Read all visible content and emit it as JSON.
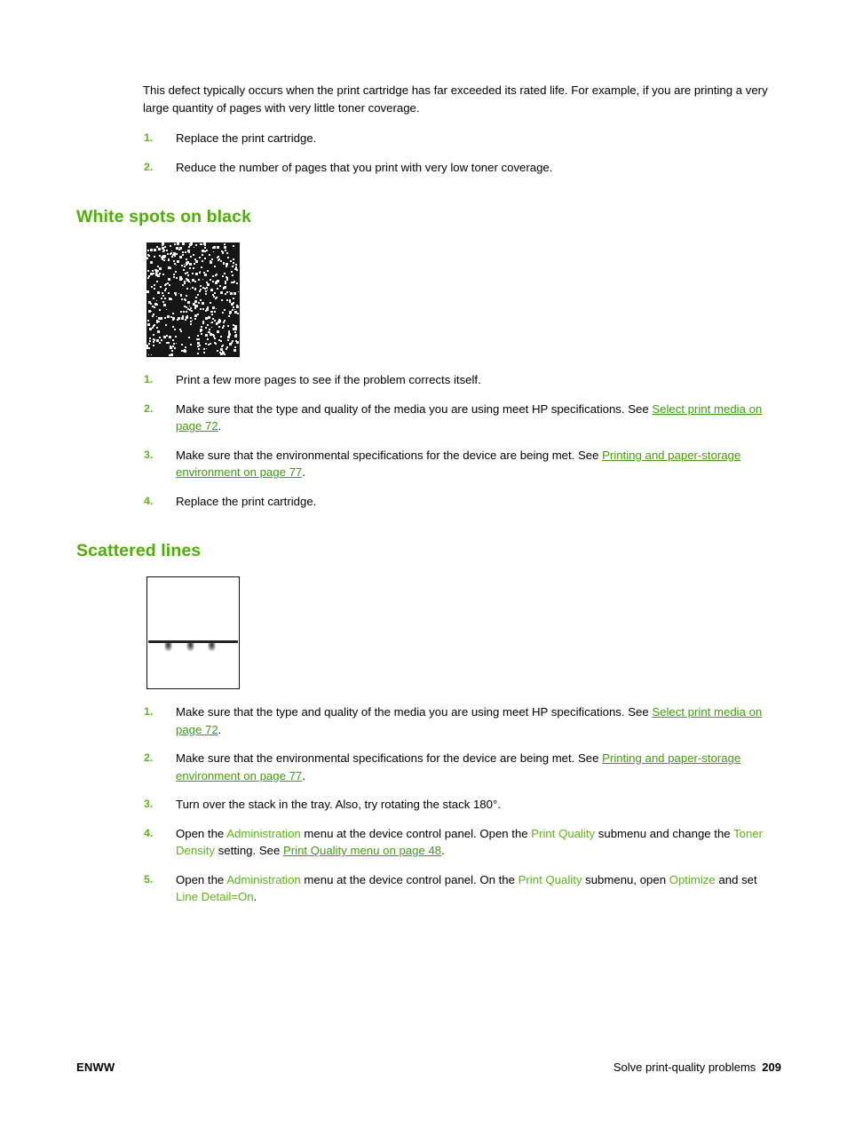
{
  "colors": {
    "heading_green": "#4fae05",
    "link_green": "#3da00b",
    "uiterm_green": "#5cb615",
    "list_number_green": "#5cb615",
    "body_black": "#000000"
  },
  "intro": {
    "paragraph": "This defect typically occurs when the print cartridge has far exceeded its rated life. For example, if you are printing a very large quantity of pages with very little toner coverage.",
    "steps": [
      {
        "num": "1.",
        "text": "Replace the print cartridge."
      },
      {
        "num": "2.",
        "text": "Reduce the number of pages that you print with very low toner coverage."
      }
    ]
  },
  "sections": [
    {
      "heading": "White spots on black",
      "figure": {
        "name": "white-spots-on-black-sample",
        "type": "black-field-with-white-speckles",
        "alt": "Print sample showing white spots on a solid black field"
      },
      "steps": [
        {
          "num": "1.",
          "parts": [
            {
              "type": "text",
              "value": "Print a few more pages to see if the problem corrects itself."
            }
          ]
        },
        {
          "num": "2.",
          "parts": [
            {
              "type": "text",
              "value": "Make sure that the type and quality of the media you are using meet HP specifications. See "
            },
            {
              "type": "link",
              "value": "Select print media on page 72"
            },
            {
              "type": "text",
              "value": "."
            }
          ]
        },
        {
          "num": "3.",
          "parts": [
            {
              "type": "text",
              "value": "Make sure that the environmental specifications for the device are being met. See "
            },
            {
              "type": "link",
              "value": "Printing and paper-storage environment on page 77"
            },
            {
              "type": "text",
              "value": "."
            }
          ]
        },
        {
          "num": "4.",
          "parts": [
            {
              "type": "text",
              "value": "Replace the print cartridge."
            }
          ]
        }
      ]
    },
    {
      "heading": "Scattered lines",
      "figure": {
        "name": "scattered-lines-sample",
        "type": "white-page-with-horizontal-line-and-smudges",
        "alt": "Print sample showing a scattered horizontal line with smudges on a white page"
      },
      "steps": [
        {
          "num": "1.",
          "parts": [
            {
              "type": "text",
              "value": "Make sure that the type and quality of the media you are using meet HP specifications. See "
            },
            {
              "type": "link",
              "value": "Select print media on page 72"
            },
            {
              "type": "text",
              "value": "."
            }
          ]
        },
        {
          "num": "2.",
          "parts": [
            {
              "type": "text",
              "value": "Make sure that the environmental specifications for the device are being met. See "
            },
            {
              "type": "link",
              "value": "Printing and paper-storage environment on page 77"
            },
            {
              "type": "text",
              "value": "."
            }
          ]
        },
        {
          "num": "3.",
          "parts": [
            {
              "type": "text",
              "value": "Turn over the stack in the tray. Also, try rotating the stack 180°."
            }
          ]
        },
        {
          "num": "4.",
          "parts": [
            {
              "type": "text",
              "value": "Open the "
            },
            {
              "type": "uiterm",
              "value": "Administration"
            },
            {
              "type": "text",
              "value": " menu at the device control panel. Open the "
            },
            {
              "type": "uiterm",
              "value": "Print Quality"
            },
            {
              "type": "text",
              "value": " submenu and change the "
            },
            {
              "type": "uiterm",
              "value": "Toner Density"
            },
            {
              "type": "text",
              "value": " setting. See "
            },
            {
              "type": "link",
              "value": "Print Quality menu on page 48"
            },
            {
              "type": "text",
              "value": "."
            }
          ]
        },
        {
          "num": "5.",
          "parts": [
            {
              "type": "text",
              "value": "Open the "
            },
            {
              "type": "uiterm",
              "value": "Administration"
            },
            {
              "type": "text",
              "value": " menu at the device control panel. On the "
            },
            {
              "type": "uiterm",
              "value": "Print Quality"
            },
            {
              "type": "text",
              "value": " submenu, open "
            },
            {
              "type": "uiterm",
              "value": "Optimize"
            },
            {
              "type": "text",
              "value": " and set "
            },
            {
              "type": "uiterm",
              "value": "Line Detail=On"
            },
            {
              "type": "text",
              "value": "."
            }
          ]
        }
      ]
    }
  ],
  "footer": {
    "left": "ENWW",
    "right_title": "Solve print-quality problems",
    "page_number": "209"
  }
}
